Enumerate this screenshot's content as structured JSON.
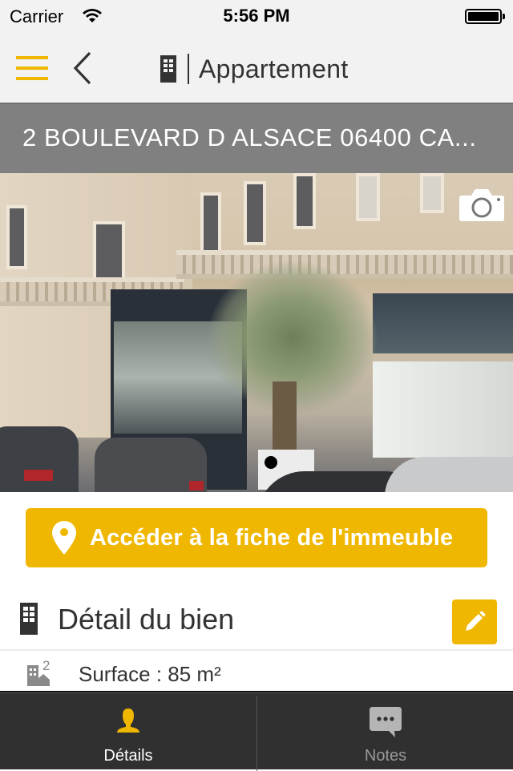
{
  "status_bar": {
    "carrier": "Carrier",
    "time": "5:56 PM",
    "wifi_icon": "wifi-icon",
    "battery_icon": "battery-full-icon"
  },
  "nav_bar": {
    "menu_icon": "hamburger-menu-icon",
    "back_icon": "chevron-left-icon",
    "title_icon": "building-icon",
    "title": "Appartement"
  },
  "address": {
    "text": "2 BOULEVARD D ALSACE 06400 CA..."
  },
  "photo": {
    "description": "Street view photo of building facade",
    "camera_icon": "camera-icon",
    "page_indicator_count": 1
  },
  "cta_button": {
    "icon": "map-pin-icon",
    "label": "Accéder à la fiche de l'immeuble"
  },
  "detail_section": {
    "icon": "building-icon",
    "title": "Détail du bien",
    "edit_icon": "pencil-icon",
    "rows": [
      {
        "icon": "surface-area-icon",
        "label": "Surface : 85 m²"
      }
    ]
  },
  "tab_bar": {
    "tabs": [
      {
        "label": "Détails",
        "icon": "person-icon",
        "active": true
      },
      {
        "label": "Notes",
        "icon": "chat-bubble-icon",
        "active": false
      }
    ]
  },
  "colors": {
    "accent": "#f0b700",
    "nav_background": "#f2f2f2",
    "address_bar": "#808080",
    "tab_bar": "#303030",
    "text_dark": "#333333",
    "tab_inactive": "#9a9a9a"
  }
}
